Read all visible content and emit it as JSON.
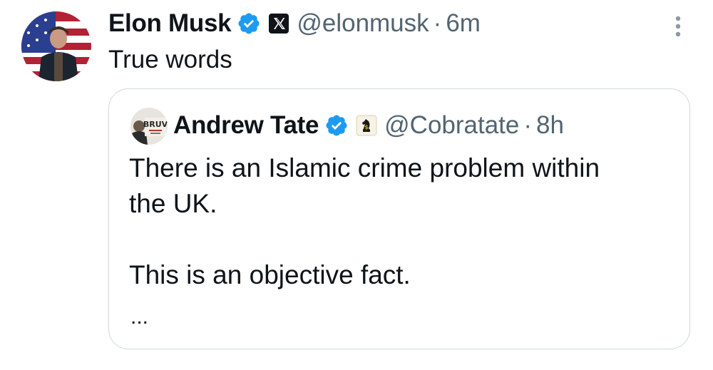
{
  "tweet": {
    "author_name": "Elon Musk",
    "handle": "@elonmusk",
    "separator": "·",
    "time": "6m",
    "text": "True words",
    "affiliation_icon": "x-logo-icon",
    "verified_color": "#1d9bf0"
  },
  "quoted_tweet": {
    "author_name": "Andrew Tate",
    "handle": "@Cobratate",
    "separator": "·",
    "time": "8h",
    "body": "There is an Islamic crime problem within\nthe UK.\n\nThis is an objective fact.",
    "ellipsis": "...",
    "avatar_text": "BRUV",
    "affiliation_icon": "chess-knight-dollar-icon"
  },
  "colors": {
    "text": "#0f1419",
    "secondary": "#536471",
    "border": "#cfd9de",
    "verified": "#1d9bf0"
  }
}
